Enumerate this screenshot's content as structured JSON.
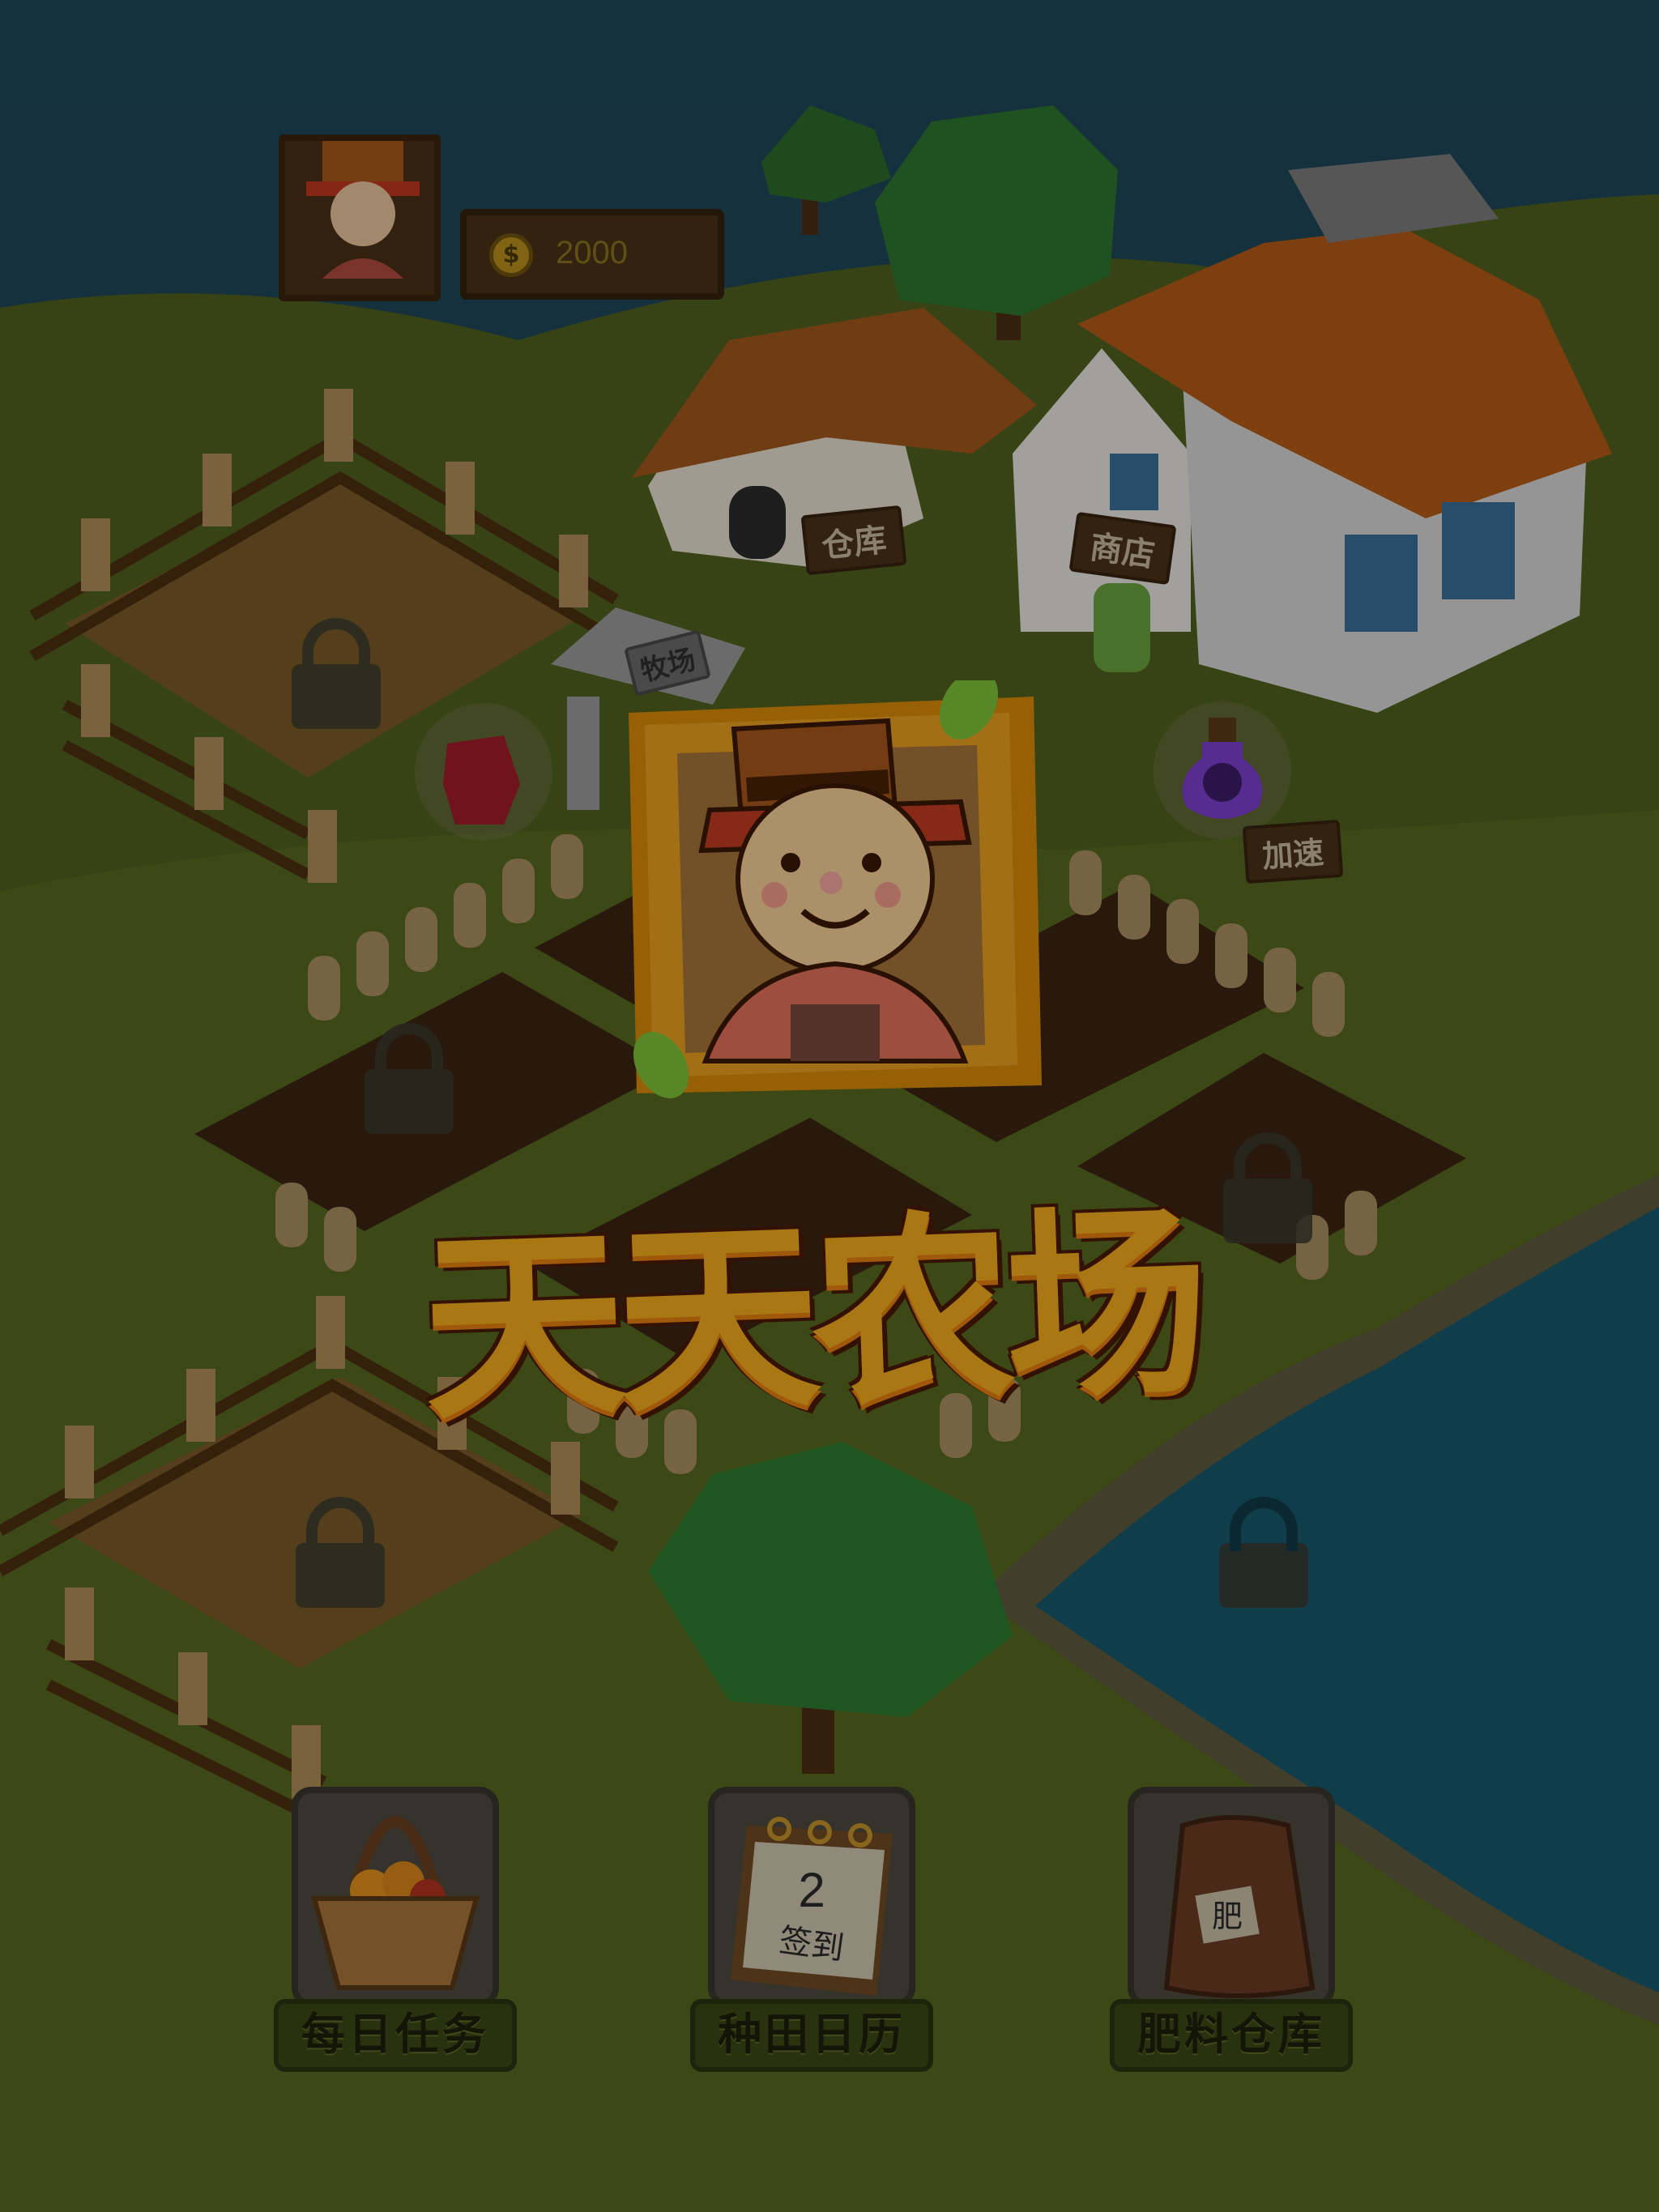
{
  "hud": {
    "coins": "2000",
    "coin_symbol": "$"
  },
  "buildings": {
    "warehouse_sign": "仓库",
    "shop_sign": "商店",
    "ranch_sign": "牧场"
  },
  "items": {
    "speedup_sign": "加速"
  },
  "title": {
    "text": "天天农场"
  },
  "menu": {
    "daily_tasks": "每日任务",
    "farm_calendar": "种田日历",
    "fertilizer_storage": "肥料仓库"
  },
  "calendar_icon": {
    "day": "2",
    "label": "签到"
  },
  "fertilizer_icon": {
    "label": "肥"
  },
  "colors": {
    "title_yellow": "#f2ad1d",
    "title_outline": "#4b1b05",
    "grass": "#36411a",
    "water": "#0f3a46",
    "button_green": "#3d4716"
  }
}
